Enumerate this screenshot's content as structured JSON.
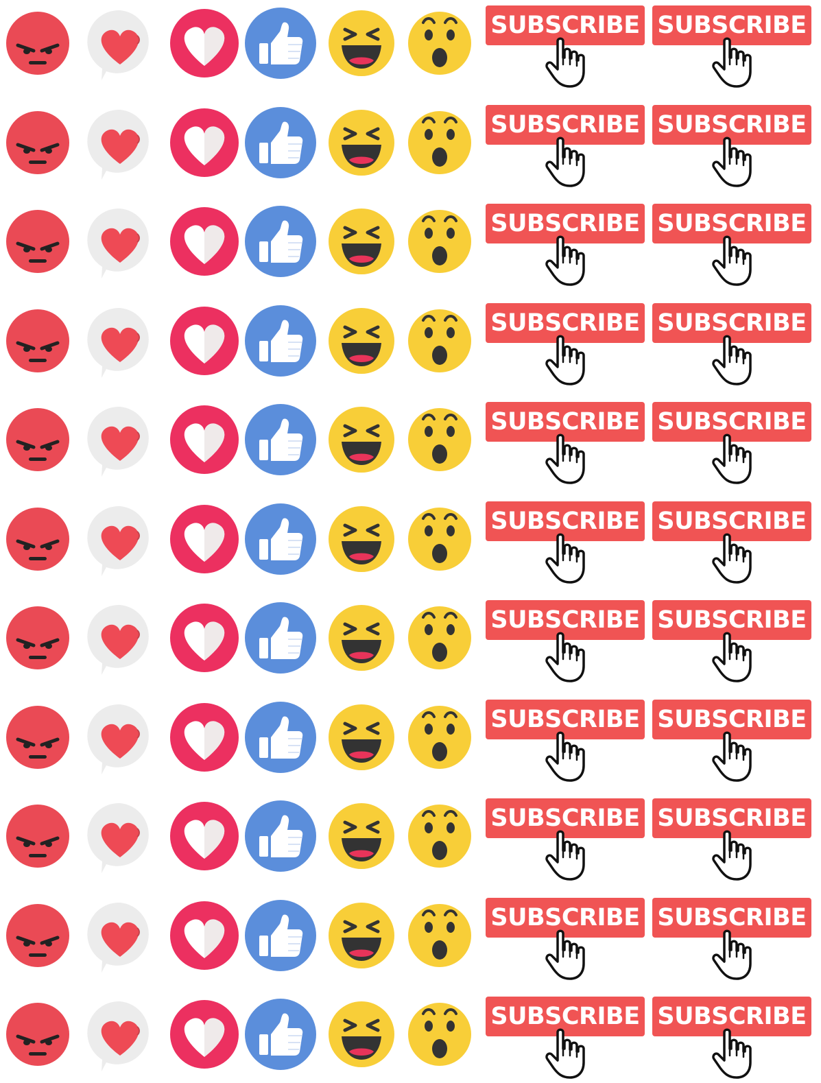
{
  "sheet": {
    "background": "#ffffff",
    "rows": 11
  },
  "reactions": [
    {
      "name": "angry",
      "icon": "angry-face-icon",
      "color": "#ea4a55"
    },
    {
      "name": "love-bubble",
      "icon": "heart-speech-bubble-icon",
      "color": "#ee4a55"
    },
    {
      "name": "love",
      "icon": "heart-circle-icon",
      "color": "#ec3060"
    },
    {
      "name": "like",
      "icon": "thumbs-up-icon",
      "color": "#5b8edb"
    },
    {
      "name": "haha",
      "icon": "laughing-face-icon",
      "color": "#f8ce38"
    },
    {
      "name": "wow",
      "icon": "surprised-face-icon",
      "color": "#f8ce38"
    }
  ],
  "subscribe": {
    "label": "SUBSCRIBE",
    "color": "#f05454",
    "text_color": "#ffffff",
    "icon": "pointing-hand-cursor-icon",
    "copies_per_row": 2
  }
}
